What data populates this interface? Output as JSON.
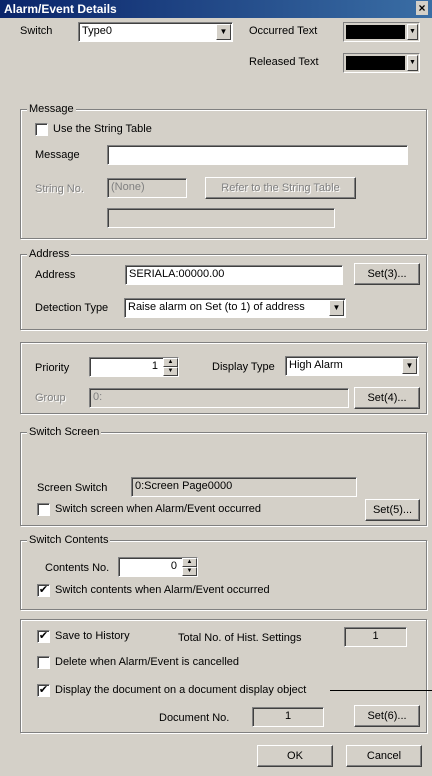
{
  "window": {
    "title": "Alarm/Event Details",
    "close": "×"
  },
  "top": {
    "switch_label": "Switch",
    "switch_value": "Type0",
    "occurred_label": "Occurred Text",
    "released_label": "Released Text",
    "occurred_color": "#000000",
    "released_color": "#000000"
  },
  "message": {
    "group": "Message",
    "use_string_table": "Use the String Table",
    "use_string_table_checked": false,
    "message_label": "Message",
    "message_value": "",
    "string_no_label": "String No.",
    "string_no_value": "(None)",
    "refer_button": "Refer to the String Table",
    "string_preview": ""
  },
  "address": {
    "group": "Address",
    "address_label": "Address",
    "address_value": "SERIALA:00000.00",
    "set_button": "Set(3)...",
    "detection_label": "Detection Type",
    "detection_value": "Raise alarm on Set (to 1) of address"
  },
  "priority": {
    "priority_label": "Priority",
    "priority_value": "1",
    "display_type_label": "Display Type",
    "display_type_value": "High Alarm",
    "group_label": "Group",
    "group_value": "0:",
    "set_button": "Set(4)..."
  },
  "switch_screen": {
    "group": "Switch Screen",
    "screen_switch_label": "Screen Switch",
    "screen_switch_value": "0:Screen Page0000",
    "checkbox": "Switch screen when Alarm/Event occurred",
    "checkbox_checked": false,
    "set_button": "Set(5)..."
  },
  "switch_contents": {
    "group": "Switch Contents",
    "contents_no_label": "Contents No.",
    "contents_no_value": "0",
    "checkbox": "Switch contents when Alarm/Event occurred",
    "checkbox_checked": true
  },
  "history": {
    "save_label": "Save to History",
    "save_checked": true,
    "total_label": "Total No. of Hist. Settings",
    "total_value": "1",
    "delete_label": "Delete when Alarm/Event is cancelled",
    "delete_checked": false,
    "display_doc_label": "Display the document on a document display object",
    "display_doc_checked": true,
    "doc_no_label": "Document No.",
    "doc_no_value": "1",
    "set_button": "Set(6)..."
  },
  "footer": {
    "ok": "OK",
    "cancel": "Cancel"
  },
  "check_mark": "✔",
  "arrow_down": "▼",
  "arrow_up": "▲"
}
